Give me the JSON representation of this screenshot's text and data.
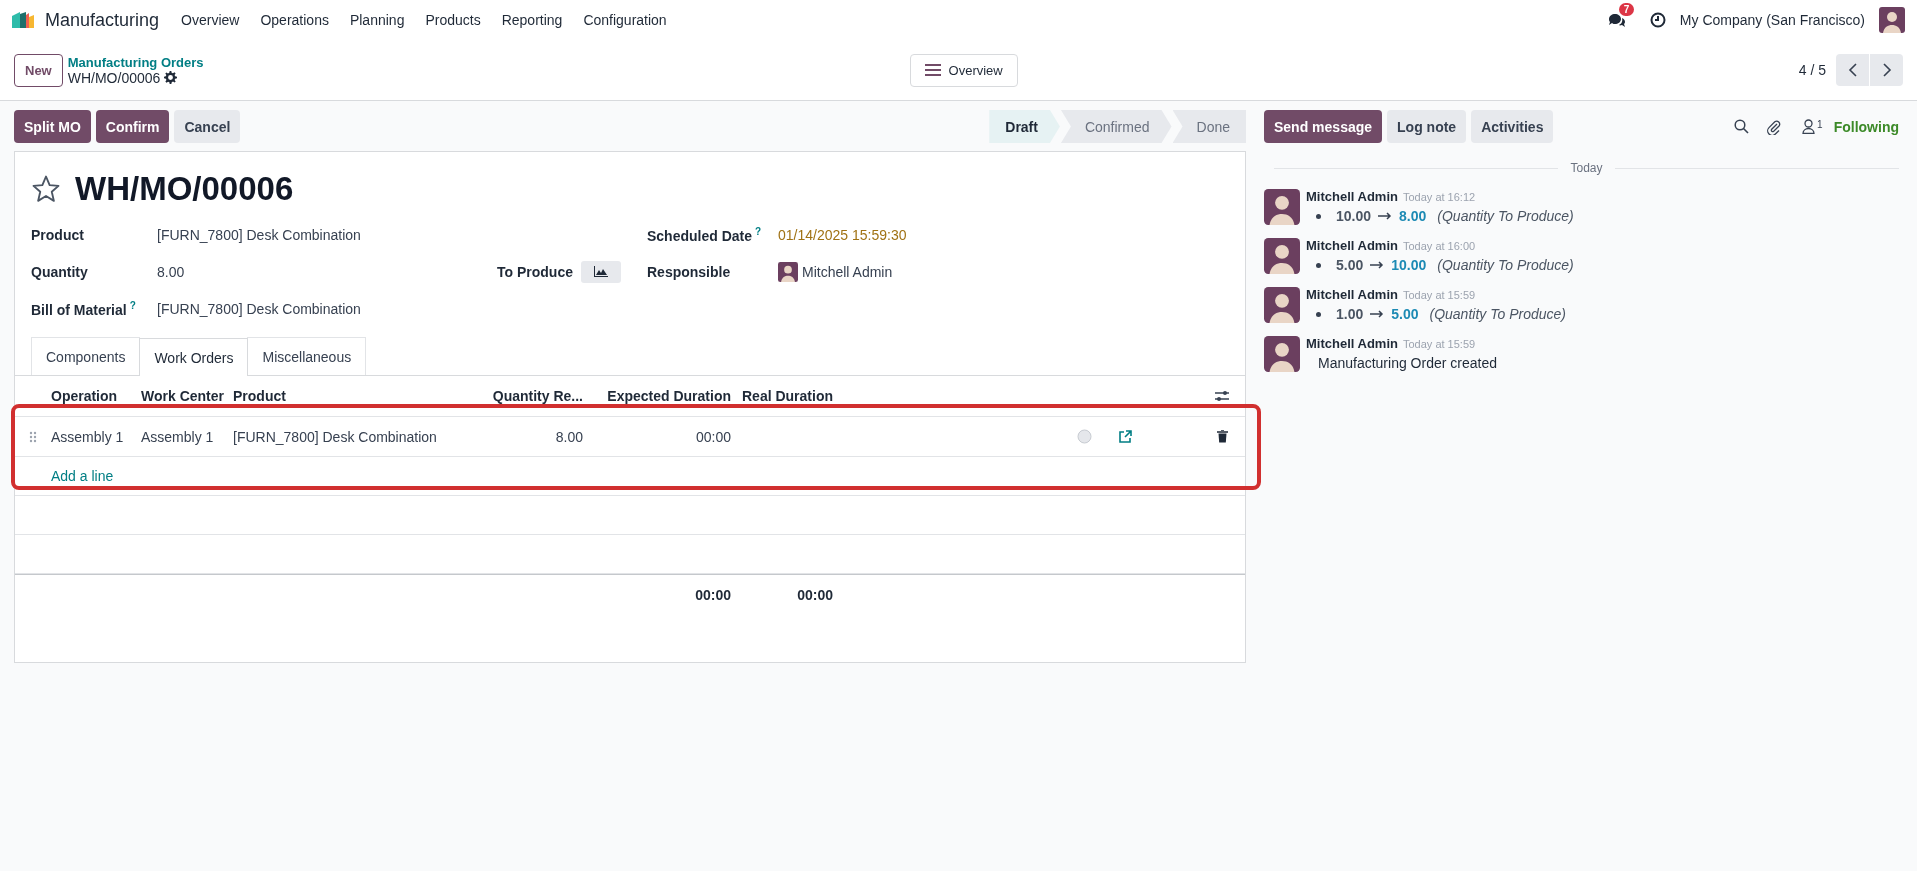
{
  "navbar": {
    "app_name": "Manufacturing",
    "menu": [
      "Overview",
      "Operations",
      "Planning",
      "Products",
      "Reporting",
      "Configuration"
    ],
    "messages_badge": "7",
    "company": "My Company (San Francisco)"
  },
  "control_panel": {
    "new_button": "New",
    "breadcrumb": "Manufacturing Orders",
    "record": "WH/MO/00006",
    "view_button": "Overview",
    "pager": "4 / 5"
  },
  "actions": [
    {
      "label": "Split MO",
      "primary": true
    },
    {
      "label": "Confirm",
      "primary": true
    },
    {
      "label": "Cancel",
      "primary": false
    }
  ],
  "status_steps": [
    {
      "label": "Draft",
      "selected": true
    },
    {
      "label": "Confirmed",
      "selected": false
    },
    {
      "label": "Done",
      "selected": false
    }
  ],
  "form": {
    "title": "WH/MO/00006",
    "starred": false,
    "fields": [
      {
        "label": "Product",
        "value": "[FURN_7800] Desk Combination"
      },
      {
        "label": "Quantity",
        "value": "8.00"
      },
      {
        "label": "Bill of Material",
        "help": "?",
        "value": "[FURN_7800] Desk Combination"
      }
    ],
    "to_produce": "To Produce",
    "right_fields": [
      {
        "label": "Scheduled Date",
        "help": "?",
        "value": "01/14/2025 15:59:30",
        "kind": "date"
      },
      {
        "label": "Responsible",
        "value": "Mitchell Admin",
        "kind": "user"
      }
    ],
    "tabs": [
      {
        "label": "Components",
        "selected": false
      },
      {
        "label": "Work Orders",
        "selected": true
      },
      {
        "label": "Miscellaneous",
        "selected": false
      }
    ],
    "table": {
      "columns": [
        "Operation",
        "Work Center",
        "Product",
        "Quantity Re...",
        "Expected Duration",
        "Real Duration"
      ],
      "rows": [
        {
          "operation": "Assembly 1",
          "work_center": "Assembly 1",
          "product": "[FURN_7800] Desk Combination",
          "quantity": "8.00",
          "expected_duration": "00:00"
        }
      ],
      "add_line": "Add a line",
      "totals": {
        "expected_duration": "00:00",
        "real_duration": "00:00"
      }
    }
  },
  "chatter": {
    "buttons": [
      {
        "label": "Send message",
        "primary": true
      },
      {
        "label": "Log note",
        "primary": false
      },
      {
        "label": "Activities",
        "primary": false
      }
    ],
    "followers_count": "1",
    "follow_status": "Following",
    "date_separator": "Today",
    "messages": [
      {
        "author": "Mitchell Admin",
        "time": "Today at 16:12",
        "kind": "tracking",
        "old": "10.00",
        "new": "8.00",
        "field": "(Quantity To Produce)"
      },
      {
        "author": "Mitchell Admin",
        "time": "Today at 16:00",
        "kind": "tracking",
        "old": "5.00",
        "new": "10.00",
        "field": "(Quantity To Produce)"
      },
      {
        "author": "Mitchell Admin",
        "time": "Today at 15:59",
        "kind": "tracking",
        "old": "1.00",
        "new": "5.00",
        "field": "(Quantity To Produce)"
      },
      {
        "author": "Mitchell Admin",
        "time": "Today at 15:59",
        "kind": "note",
        "body": "Manufacturing Order created"
      }
    ]
  }
}
